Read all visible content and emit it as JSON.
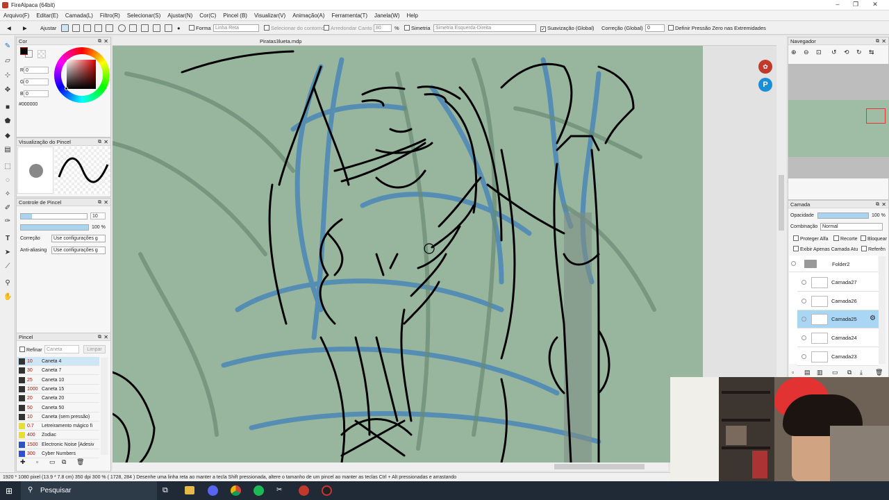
{
  "window": {
    "title": "FireAlpaca (64bit)"
  },
  "menu": [
    "Arquivo(F)",
    "Editar(E)",
    "Camada(L)",
    "Filtro(R)",
    "Selecionar(S)",
    "Ajustar(N)",
    "Cor(C)",
    "Pincel (B)",
    "Visualizar(V)",
    "Animação(A)",
    "Ferramenta(T)",
    "Janela(W)",
    "Help"
  ],
  "toolbar": {
    "ajustar": "Ajustar",
    "forma": "Forma",
    "forma_value": "Linha Reta",
    "selecionar_contorno": "Selecionar do contorno",
    "arredondar": "Arredondar Canto",
    "arredondar_value": "80",
    "percent": "%",
    "simetria": "Simetria",
    "simetria_value": "Simetria Esquerda-Direita",
    "suavizacao": "Suavização (Global)",
    "correcao": "Correção (Global)",
    "correcao_value": "0",
    "pressao": "Definir Pressão Zero nas Extremidades"
  },
  "color_panel": {
    "title": "Cor",
    "r_label": "R",
    "r": "0",
    "g_label": "G",
    "g": "0",
    "b_label": "B",
    "b": "0",
    "hex": "#000000",
    "fg": "#000000",
    "bg": "#ffffff"
  },
  "brush_preview": {
    "title": "Visualização do Pincel"
  },
  "brush_control": {
    "title": "Controle de Pincel",
    "size": "10",
    "opacity": "100 %",
    "correcao_label": "Correção",
    "correcao_value": "Use configurações g",
    "aa_label": "Anti-aliasing",
    "aa_value": "Use configurações g"
  },
  "brush_panel": {
    "title": "Pincel",
    "refinar": "Refinar",
    "caneta": "Caneta",
    "limpar": "Limpar",
    "items": [
      {
        "size": "10",
        "name": "Caneta 4",
        "color": "#333333"
      },
      {
        "size": "30",
        "name": "Caneta 7",
        "color": "#333333"
      },
      {
        "size": "25",
        "name": "Caneta 10",
        "color": "#333333"
      },
      {
        "size": "1000",
        "name": "Caneta 15",
        "color": "#333333"
      },
      {
        "size": "20",
        "name": "Caneta 20",
        "color": "#333333"
      },
      {
        "size": "50",
        "name": "Caneta 50",
        "color": "#333333"
      },
      {
        "size": "10",
        "name": "Caneta (sem pressão)",
        "color": "#333333"
      },
      {
        "size": "0.7",
        "name": "Letreiramento mágico fi",
        "color": "#e8e030"
      },
      {
        "size": "400",
        "name": "Zodiac",
        "color": "#e8e030"
      },
      {
        "size": "1500",
        "name": "Electronic Noise [Adesiv",
        "color": "#3050d0"
      },
      {
        "size": "300",
        "name": "Cyber Numbers",
        "color": "#3050d0"
      }
    ]
  },
  "document": {
    "tab": "Piratas3lueta.mdp"
  },
  "navigator": {
    "title": "Navegador"
  },
  "layer_panel": {
    "title": "Camada",
    "opacidade_label": "Opacidade",
    "opacidade": "100 %",
    "combinacao_label": "Combinação",
    "combinacao": "Normal",
    "proteger": "Proteger Alfa",
    "recorte": "Recorte",
    "bloquear": "Bloquear",
    "exibir": "Exibir Apenas Camada Atu",
    "referencia": "Referên",
    "folder": "Folder2",
    "layers": [
      "Camada27",
      "Camada26",
      "Camada25",
      "Camada24",
      "Camada23"
    ],
    "selected_index": 2
  },
  "statusbar": "1920 * 1080 pixel  (13.9 * 7.8 cm)  350 dpi  300 %  ( 1728, 284 )  Desenhe uma linha reta ao manter a tecla Shift pressionada, altere o tamanho de um pincel ao manter as teclas Ctrl + Alt pressionadas e arrastando",
  "taskbar": {
    "search": "Pesquisar"
  }
}
